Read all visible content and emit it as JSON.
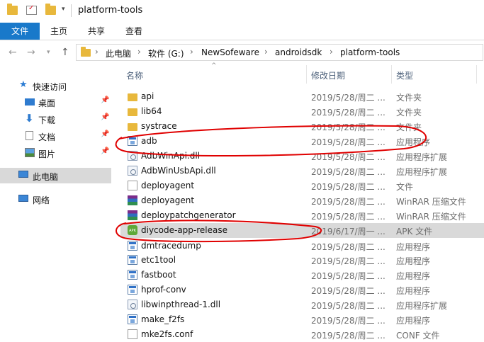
{
  "window": {
    "title": "platform-tools"
  },
  "ribbon": {
    "tabs": [
      "文件",
      "主页",
      "共享",
      "查看"
    ]
  },
  "address": {
    "crumbs": [
      "此电脑",
      "软件 (G:)",
      "NewSofeware",
      "androidsdk",
      "platform-tools"
    ]
  },
  "nav": {
    "quick_access": "快速访问",
    "items": [
      "桌面",
      "下载",
      "文档",
      "图片"
    ],
    "this_pc": "此电脑",
    "network": "网络"
  },
  "columns": {
    "name": "名称",
    "date": "修改日期",
    "type": "类型"
  },
  "files": [
    {
      "name": "api",
      "date": "2019/5/28/周二 ...",
      "type": "文件夹",
      "icon": "folder-icon"
    },
    {
      "name": "lib64",
      "date": "2019/5/28/周二 ...",
      "type": "文件夹",
      "icon": "folder-icon"
    },
    {
      "name": "systrace",
      "date": "2019/5/28/周二 ...",
      "type": "文件夹",
      "icon": "folder-icon"
    },
    {
      "name": "adb",
      "date": "2019/5/28/周二 ...",
      "type": "应用程序",
      "icon": "exe-icon"
    },
    {
      "name": "AdbWinApi.dll",
      "date": "2019/5/28/周二 ...",
      "type": "应用程序扩展",
      "icon": "dll-icon"
    },
    {
      "name": "AdbWinUsbApi.dll",
      "date": "2019/5/28/周二 ...",
      "type": "应用程序扩展",
      "icon": "dll-icon"
    },
    {
      "name": "deployagent",
      "date": "2019/5/28/周二 ...",
      "type": "文件",
      "icon": "file-icon"
    },
    {
      "name": "deployagent",
      "date": "2019/5/28/周二 ...",
      "type": "WinRAR 压缩文件",
      "icon": "rar-icon"
    },
    {
      "name": "deploypatchgenerator",
      "date": "2019/5/28/周二 ...",
      "type": "WinRAR 压缩文件",
      "icon": "rar-icon"
    },
    {
      "name": "diycode-app-release",
      "date": "2019/6/17/周一 ...",
      "type": "APK 文件",
      "icon": "apk-icon"
    },
    {
      "name": "dmtracedump",
      "date": "2019/5/28/周二 ...",
      "type": "应用程序",
      "icon": "exe-icon"
    },
    {
      "name": "etc1tool",
      "date": "2019/5/28/周二 ...",
      "type": "应用程序",
      "icon": "exe-icon"
    },
    {
      "name": "fastboot",
      "date": "2019/5/28/周二 ...",
      "type": "应用程序",
      "icon": "exe-icon"
    },
    {
      "name": "hprof-conv",
      "date": "2019/5/28/周二 ...",
      "type": "应用程序",
      "icon": "exe-icon"
    },
    {
      "name": "libwinpthread-1.dll",
      "date": "2019/5/28/周二 ...",
      "type": "应用程序扩展",
      "icon": "dll-icon"
    },
    {
      "name": "make_f2fs",
      "date": "2019/5/28/周二 ...",
      "type": "应用程序",
      "icon": "exe-icon"
    },
    {
      "name": "mke2fs.conf",
      "date": "2019/5/28/周二 ...",
      "type": "CONF 文件",
      "icon": "file-icon"
    }
  ],
  "selected_file": "diycode-app-release",
  "colors": {
    "accent": "#1979ca",
    "annotation": "#e00000",
    "folder": "#e8b83c"
  }
}
